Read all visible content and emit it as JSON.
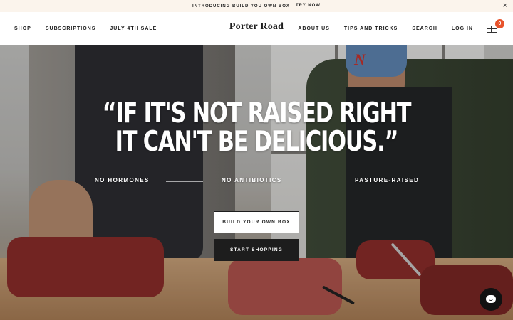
{
  "announcement": {
    "text": "INTRODUCING BUILD YOU OWN BOX",
    "link": "TRY NOW",
    "close_icon": "close-icon",
    "close_glyph": "×"
  },
  "header": {
    "nav_left": [
      "SHOP",
      "SUBSCRIPTIONS",
      "JULY 4TH SALE"
    ],
    "logo": "Porter Road",
    "nav_right": [
      "ABOUT US",
      "TIPS AND TRICKS",
      "SEARCH",
      "LOG IN"
    ],
    "cart_icon": "cart-box-icon",
    "cart_count": "0",
    "accent_color": "#e8532b"
  },
  "hero": {
    "quote_line1": "“IF IT'S NOT RAISED RIGHT",
    "quote_line2": "IT CAN'T BE DELICIOUS.”",
    "badges": [
      "NO HORMONES",
      "NO ANTIBIOTICS",
      "PASTURE-RAISED"
    ],
    "buttons": {
      "build": "BUILD YOUR OWN BOX",
      "shop": "START SHOPPING"
    },
    "cap_letter": "N"
  },
  "chat": {
    "icon": "chat-bubble-icon"
  }
}
